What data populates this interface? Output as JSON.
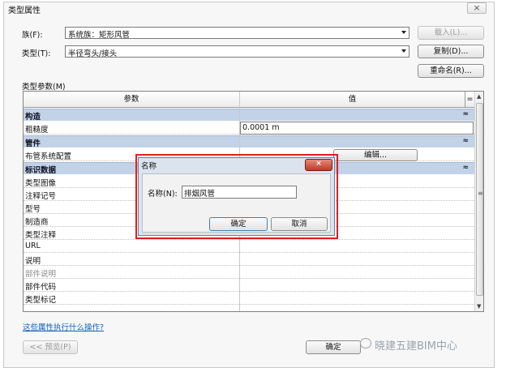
{
  "window": {
    "title": "类型属性",
    "close_label": "×"
  },
  "family": {
    "label": "族(F):",
    "value": "系统族：矩形风管",
    "load_label": "载入(L)..."
  },
  "type": {
    "label": "类型(T):",
    "value": "半径弯头/接头",
    "duplicate_label": "复制(D)...",
    "rename_label": "重命名(R)..."
  },
  "params_label": "类型参数(M)",
  "grid": {
    "col_param": "参数",
    "col_value": "值",
    "col_extra": "=",
    "groups": [
      {
        "title": "构造",
        "collapse": "≈",
        "rows": [
          {
            "name": "粗糙度",
            "value": "0.0001 m"
          }
        ]
      },
      {
        "title": "管件",
        "collapse": "≈",
        "rows": [
          {
            "name": "布管系统配置",
            "value": "编辑..."
          }
        ]
      },
      {
        "title": "标识数据",
        "collapse": "≈",
        "rows": [
          {
            "name": "类型图像"
          },
          {
            "name": "注释记号"
          },
          {
            "name": "型号"
          },
          {
            "name": "制造商"
          },
          {
            "name": "类型注释"
          },
          {
            "name": "URL"
          },
          {
            "name": "说明"
          },
          {
            "name": "部件说明"
          },
          {
            "name": "部件代码"
          },
          {
            "name": "类型标记"
          }
        ]
      }
    ],
    "scroll_up": "▲",
    "scroll_down": "▼",
    "scroll_mid": "≡"
  },
  "help_link": "这些属性执行什么操作?",
  "preview_label": "<< 预览(P)",
  "ok_label": "确定",
  "dialog": {
    "title": "名称",
    "close_label": "×",
    "name_label": "名称(N):",
    "name_value": "排烟风管",
    "ok_label": "确定",
    "cancel_label": "取消"
  },
  "watermark": "晓建五建BIM中心",
  "colors": {
    "group_header": "#c2d3e8",
    "highlight": "#e21e1e",
    "link": "#1060c0"
  }
}
